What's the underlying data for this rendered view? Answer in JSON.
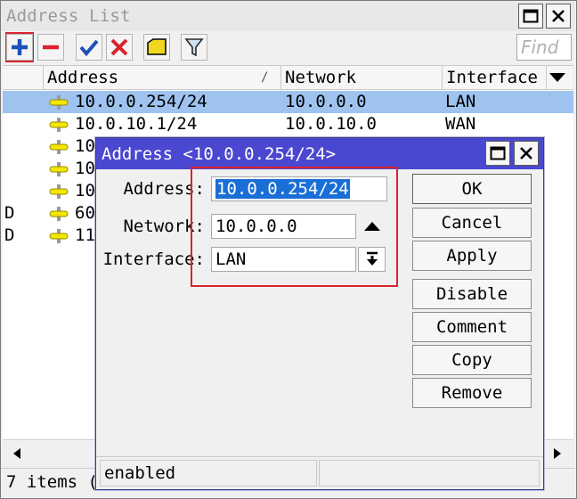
{
  "window": {
    "title": "Address List",
    "find_placeholder": "Find",
    "status_text": "7 items (1 selected)"
  },
  "toolbar": {
    "buttons": [
      "add-icon",
      "remove-icon",
      "enable-icon",
      "disable-icon",
      "comment-icon",
      "filter-icon"
    ],
    "colors": {
      "add": "#1f4fb8",
      "remove": "#d9232e",
      "enable": "#1f4fb8",
      "disable": "#d9232e",
      "comment": "#f0d820"
    }
  },
  "table": {
    "headers": {
      "address": "Address",
      "network": "Network",
      "interface": "Interface",
      "sort_arrow": "/"
    },
    "rows": [
      {
        "flag": "",
        "address": "10.0.0.254/24",
        "network": "10.0.0.0",
        "interface": "LAN",
        "selected": true
      },
      {
        "flag": "",
        "address": "10.0.10.1/24",
        "network": "10.0.10.0",
        "interface": "WAN",
        "selected": false
      },
      {
        "flag": "",
        "address": "10",
        "network": "",
        "interface": "",
        "selected": false
      },
      {
        "flag": "",
        "address": "10",
        "network": "",
        "interface": "",
        "selected": false
      },
      {
        "flag": "",
        "address": "10",
        "network": "",
        "interface": "",
        "selected": false
      },
      {
        "flag": "D",
        "address": "60",
        "network": "",
        "interface": "",
        "selected": false
      },
      {
        "flag": "D",
        "address": "11",
        "network": "",
        "interface": "",
        "selected": false
      }
    ]
  },
  "dialog": {
    "title": "Address <10.0.0.254/24>",
    "address_label": "Address:",
    "address_value": "10.0.0.254/24",
    "network_label": "Network:",
    "network_value": "10.0.0.0",
    "interface_label": "Interface:",
    "interface_value": "LAN",
    "buttons": {
      "ok": "OK",
      "cancel": "Cancel",
      "apply": "Apply",
      "disable": "Disable",
      "comment": "Comment",
      "copy": "Copy",
      "remove": "Remove"
    },
    "status": "enabled"
  },
  "colors": {
    "highlight_box": "#d9232e",
    "selected_row": "#9ec3ef",
    "dialog_titlebar": "#4a47d0"
  }
}
